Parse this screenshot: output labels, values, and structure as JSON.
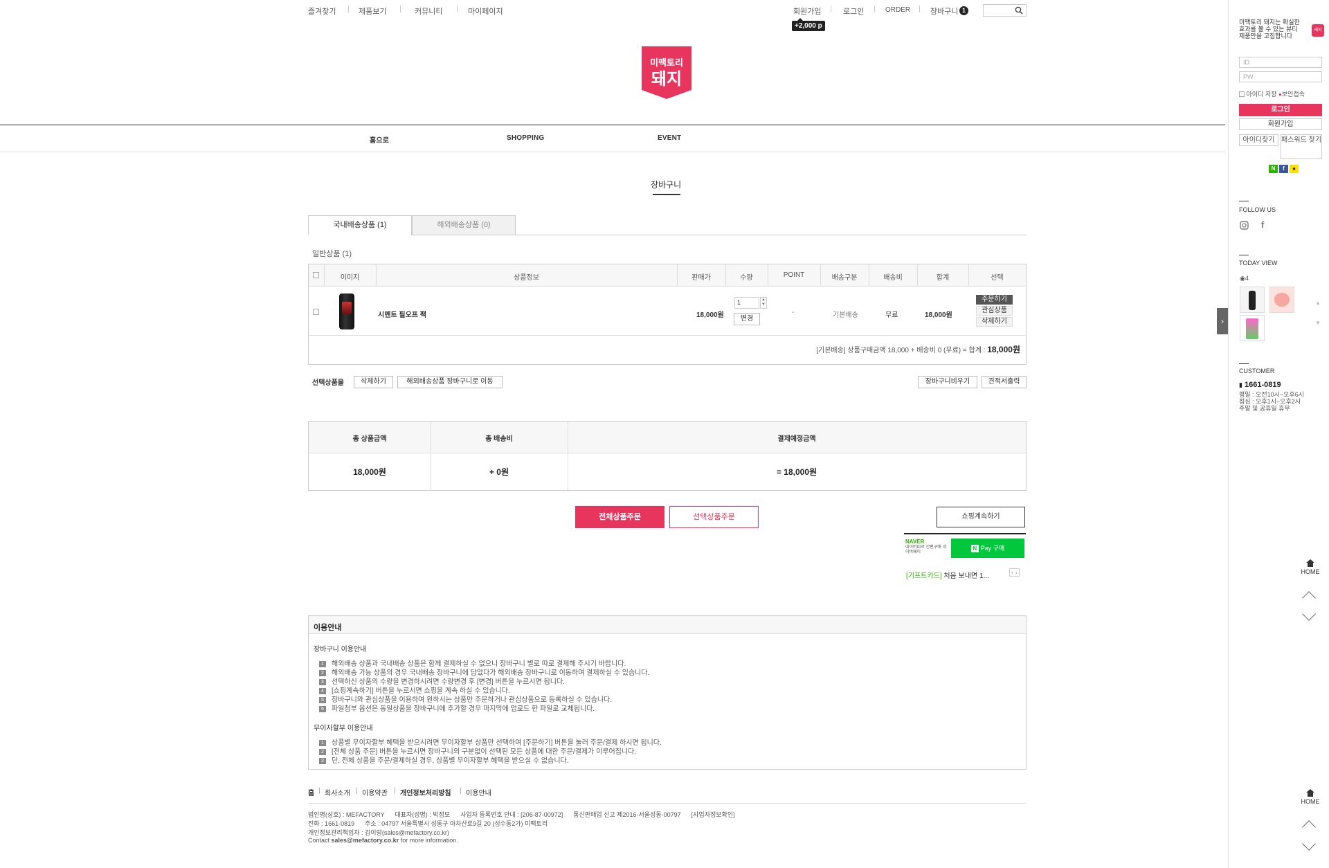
{
  "topnav": {
    "left": [
      "즐겨찾기",
      "제품보기",
      "커뮤니티",
      "마이페이지"
    ],
    "right": [
      "회원가입",
      "로그인",
      "ORDER",
      "장바구니"
    ],
    "cart_count": "1",
    "reward": "+2,000 p"
  },
  "logo": {
    "line1": "미팩토리",
    "line2": "돼지"
  },
  "gnb": [
    "홈으로",
    "SHOPPING",
    "EVENT"
  ],
  "page_title": "장바구니",
  "tabs": [
    {
      "label": "국내배송상품 (1)"
    },
    {
      "label": "해외배송상품 (0)"
    }
  ],
  "section_label": "일반상품 (1)",
  "table": {
    "headers": [
      "이미지",
      "상품정보",
      "판매가",
      "수량",
      "POINT",
      "배송구분",
      "배송비",
      "합계",
      "선택"
    ],
    "row": {
      "name": "시멘트 필오프 팩",
      "price": "18,000원",
      "qty": "1",
      "change": "변경",
      "point": "-",
      "ship_type": "기본배송",
      "ship_fee": "무료",
      "total": "18,000원",
      "actions": [
        "주문하기",
        "관심상품",
        "삭제하기"
      ]
    },
    "summary_text": "[기본배송] 상품구매금액 18,000 + 배송비 0 (무료) = 합계 :",
    "summary_total": "18,000원"
  },
  "selected": {
    "label": "선택상품을",
    "buttons": [
      "삭제하기",
      "해외배송상품 장바구니로 이동"
    ],
    "right_buttons": [
      "장바구니비우기",
      "견적서출력"
    ]
  },
  "totals": {
    "headers": [
      "총 상품금액",
      "총 배송비",
      "결제예정금액"
    ],
    "values": [
      "18,000원",
      "+ 0원",
      "= 18,000원"
    ]
  },
  "actions": {
    "all": "전체상품주문",
    "selected": "선택상품주문",
    "continue": "쇼핑계속하기"
  },
  "npay": {
    "brand": "NAVER",
    "desc": "네이버ID로 간편구매 네이버페이",
    "button": "Pay 구매",
    "news_tag": "[기프트카드]",
    "news_text": "처음 보내면 1..."
  },
  "info": {
    "title": "이용안내",
    "cart_title": "장바구니 이용안내",
    "cart_items": [
      "해외배송 상품과 국내배송 상품은 함께 결제하실 수 없으니 장바구니 별로 따로 결제해 주시기 바랍니다.",
      "해외배송 가능 상품의 경우 국내배송 장바구니에 담았다가 해외배송 장바구니로 이동하여 결제하실 수 있습니다.",
      "선택하신 상품의 수량을 변경하시려면 수량변경 후 [변경] 버튼을 누르시면 됩니다.",
      "[쇼핑계속하기] 버튼을 누르시면 쇼핑을 계속 하실 수 있습니다.",
      "장바구니와 관심상품을 이용하여 원하시는 상품만 주문하거나 관심상품으로 등록하실 수 있습니다.",
      "파일첨부 옵션은 동일상품을 장바구니에 추가할 경우 마지막에 업로드 한 파일로 교체됩니다."
    ],
    "install_title": "무이자할부 이용안내",
    "install_items": [
      "상품별 무이자할부 혜택을 받으시려면 무이자할부 상품만 선택하여 [주문하기] 버튼을 눌러 주문/결제 하시면 됩니다.",
      "[전체 상품 주문] 버튼을 누르시면 장바구니의 구분없이 선택된 모든 상품에 대한 주문/결제가 이루어집니다.",
      "단, 전체 상품을 주문/결제하실 경우, 상품별 무이자할부 혜택을 받으실 수 없습니다."
    ]
  },
  "footer": {
    "links": [
      "홈",
      "회사소개",
      "이용약관",
      "개인정보처리방침",
      "이용안내"
    ],
    "line1": "법인명(상호) : MEFACTORY      대표자(성명) : 박정모      사업자 등록번호 안내 : [206-87-00972]      통신판매업 신고 제2016-서울성동-00797      [사업자정보확인]",
    "line2": "전화 : 1661-0819      주소 : 04797 서울특별시 성동구 아차산로9길 20 (성수동2가) 미팩토리",
    "line3": "개인정보관리책임자 : 김이랑(sales@mefactory.co.kr)",
    "line4_pre": "Contact ",
    "line4_mail": "sales@mefactory.co.kr",
    "line4_post": " for more information."
  },
  "sidepanel": {
    "intro": "미팩토리 돼지는 확실한 효과를 볼 수 있는 뷰티 제품만을 고집합니다",
    "id_placeholder": "ID",
    "pw_placeholder": "PW",
    "save_id": "아이디 저장",
    "secure": "보안접속",
    "login": "로그인",
    "join": "회원가입",
    "find_id": "아이디찾기",
    "find_pw": "패스워드 찾기",
    "follow": "FOLLOW US",
    "today": "TODAY VIEW",
    "today_count": "4",
    "customer": "CUSTOMER",
    "phone": "1661-0819",
    "hours": [
      "평일 : 오전10시~오후6시",
      "점심 : 오후1시~오후2시",
      "주말 및 공휴일 휴무"
    ],
    "home": "HOME"
  },
  "colors": {
    "accent": "#e8355e",
    "npay": "#00c73c"
  }
}
